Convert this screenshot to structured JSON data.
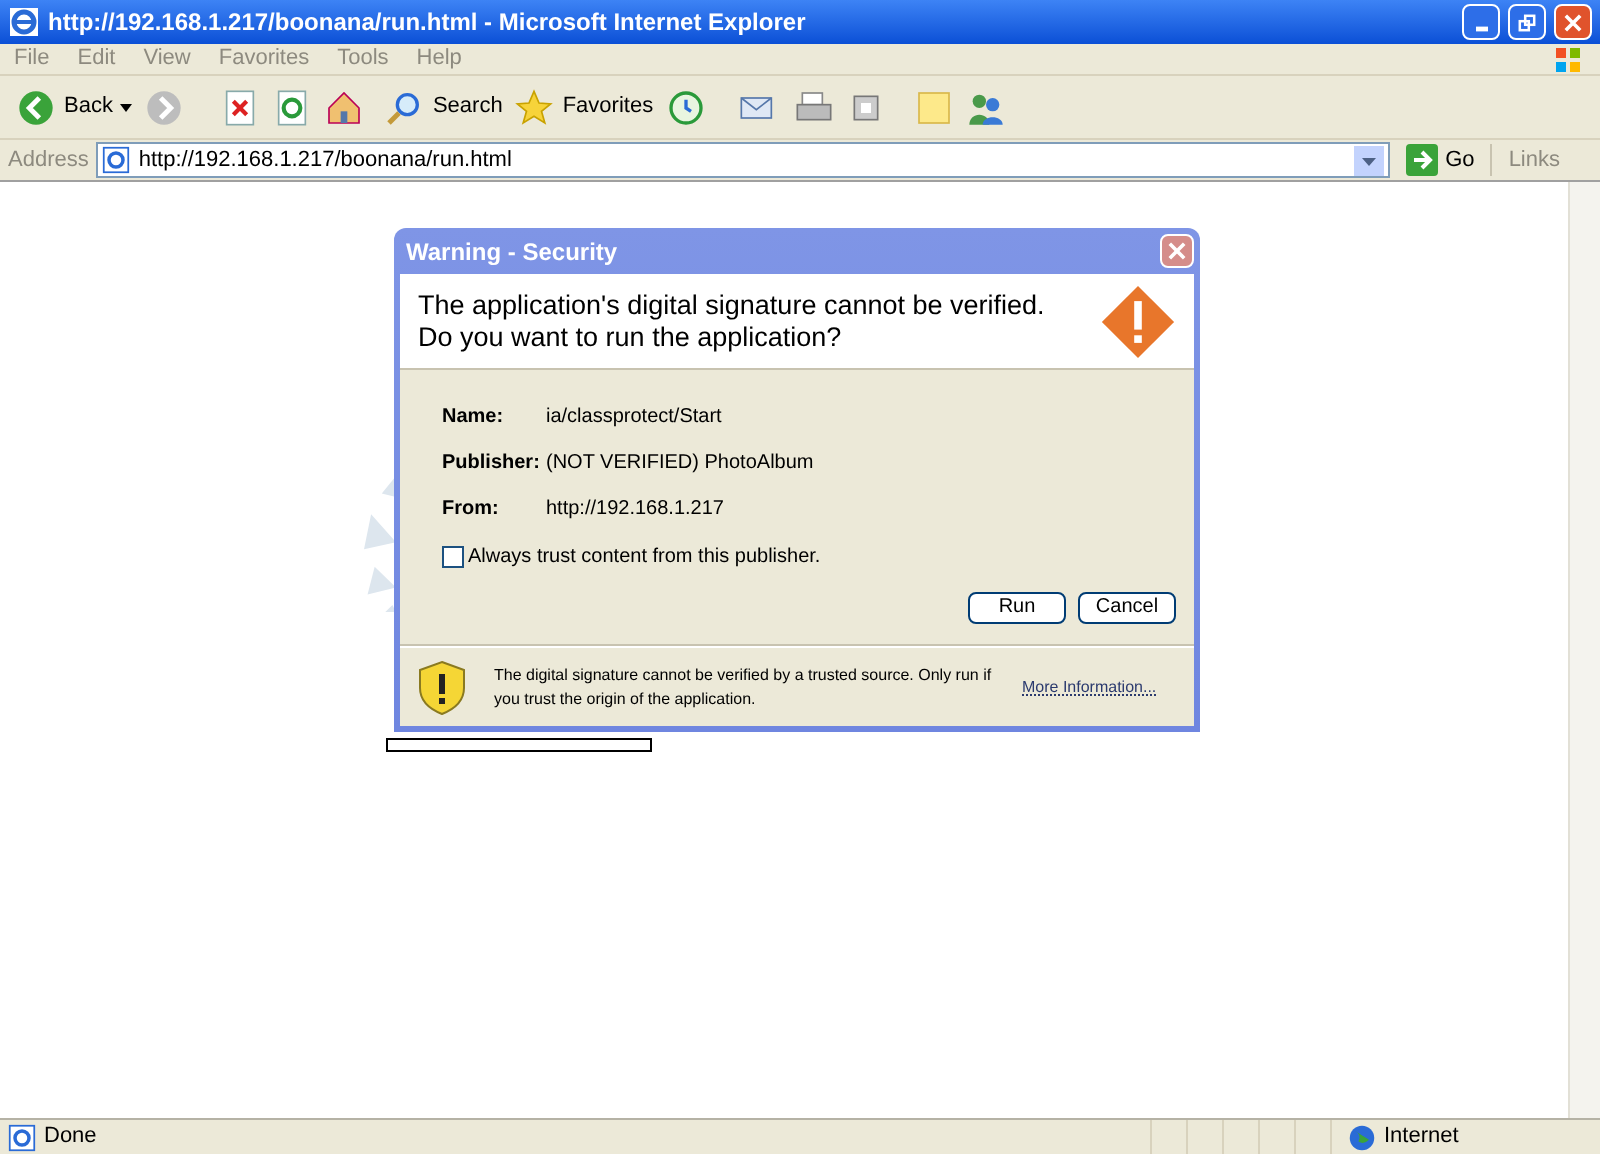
{
  "window": {
    "title": "http://192.168.1.217/boonana/run.html - Microsoft Internet Explorer"
  },
  "menu": [
    "File",
    "Edit",
    "View",
    "Favorites",
    "Tools",
    "Help"
  ],
  "toolbar": {
    "back": "Back",
    "search": "Search",
    "favorites": "Favorites"
  },
  "address": {
    "label": "Address",
    "value": "http://192.168.1.217/boonana/run.html",
    "go": "Go",
    "links": "Links"
  },
  "page": {
    "loading": {
      "level": 0
    }
  },
  "dialog": {
    "title": "Warning - Security",
    "heading": "The application's digital signature cannot be verified.",
    "question": "Do you want to run the application?",
    "fields": [
      {
        "label": "Name:",
        "value": "ia/classprotect/Start"
      },
      {
        "label": "Publisher:",
        "value": "(NOT VERIFIED) PhotoAlbum"
      },
      {
        "label": "From:",
        "value": "http://192.168.1.217"
      }
    ],
    "checkbox": {
      "label": "Always trust content from this publisher.",
      "checked": false
    },
    "buttons": [
      "Run",
      "Cancel"
    ],
    "footer": "The digital signature cannot be verified by a trusted source.  Only run if you trust the origin of the application.",
    "more": "More Information..."
  },
  "status_bar": {
    "text": "Done",
    "zone": "Internet"
  }
}
